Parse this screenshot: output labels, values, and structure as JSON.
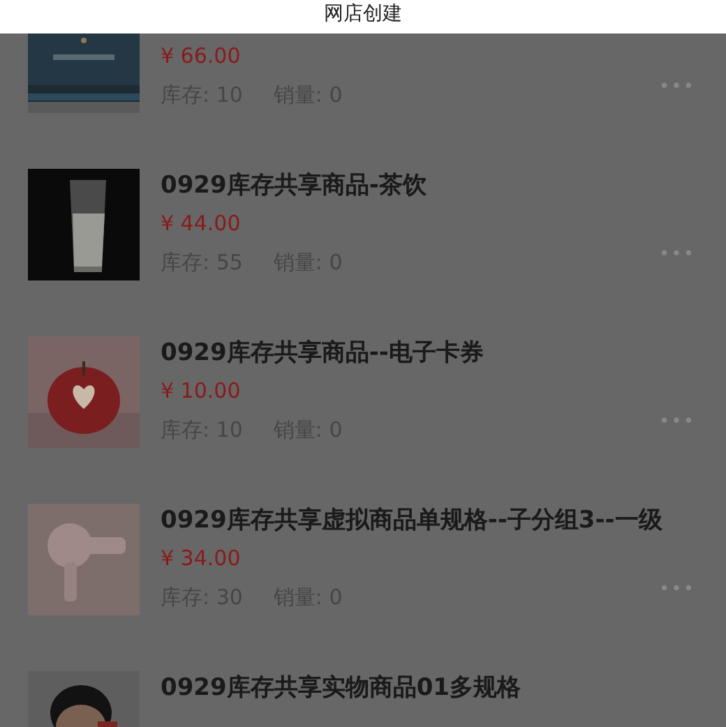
{
  "header": {
    "title": "网店创建"
  },
  "products": [
    {
      "price": "¥ 66.00",
      "stock": "库存: 10",
      "sales": "销量: 0",
      "more": "•••"
    },
    {
      "title": "0929库存共享商品-茶饮",
      "price": "¥ 44.00",
      "stock": "库存: 55",
      "sales": "销量: 0",
      "more": "•••"
    },
    {
      "title": "0929库存共享商品--电子卡券",
      "price": "¥ 10.00",
      "stock": "库存: 10",
      "sales": "销量: 0",
      "more": "•••"
    },
    {
      "title": "0929库存共享虚拟商品单规格--子分组3--一级",
      "price": "¥ 34.00",
      "stock": "库存: 30",
      "sales": "销量: 0",
      "more": "•••"
    },
    {
      "title": "0929库存共享实物商品01多规格"
    }
  ]
}
